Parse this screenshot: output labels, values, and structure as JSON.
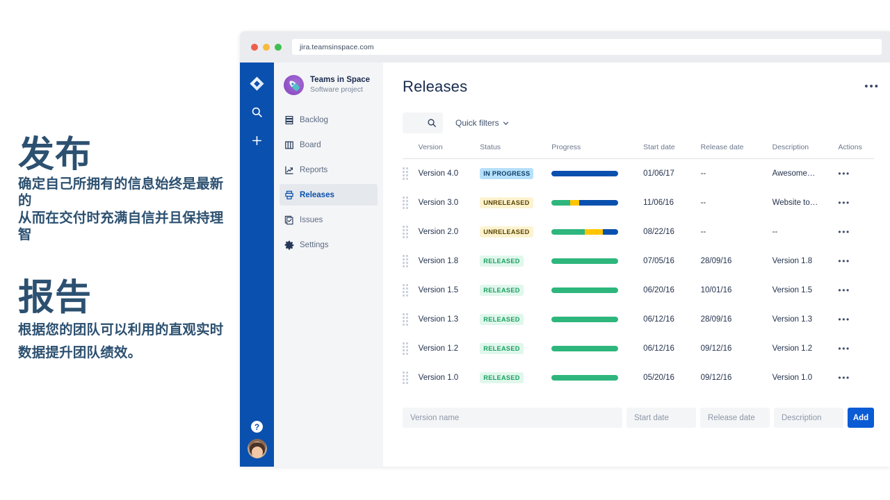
{
  "marketing": {
    "block1": {
      "heading": "发布",
      "lines": "确定自己所拥有的信息始终是最新的\n从而在交付时充满自信并且保持理智"
    },
    "block2": {
      "heading": "报告",
      "lines": "根据您的团队可以利用的直观实时数据提升团队绩效。"
    },
    "accent_color": "#2c5070"
  },
  "browser": {
    "url": "jira.teamsinspace.com",
    "traffic_lights": [
      "close-red",
      "minimize-yellow",
      "maximize-green"
    ]
  },
  "rail": {
    "logo_icon": "jira-logo-icon",
    "search_icon": "search-icon",
    "create_icon": "plus-icon",
    "help_icon": "help-icon",
    "help_label": "?",
    "avatar_icon": "user-avatar",
    "background": "#0a50ae"
  },
  "sidebar": {
    "project": {
      "name": "Teams in Space",
      "type": "Software project",
      "avatar_icon": "rocket-avatar-icon"
    },
    "items": [
      {
        "label": "Backlog",
        "icon": "backlog-icon",
        "active": false
      },
      {
        "label": "Board",
        "icon": "board-icon",
        "active": false
      },
      {
        "label": "Reports",
        "icon": "reports-icon",
        "active": false
      },
      {
        "label": "Releases",
        "icon": "releases-icon",
        "active": true
      },
      {
        "label": "Issues",
        "icon": "issues-icon",
        "active": false
      },
      {
        "label": "Settings",
        "icon": "settings-icon",
        "active": false
      }
    ]
  },
  "main": {
    "title": "Releases",
    "more_actions": "•••",
    "search": {
      "placeholder": "",
      "value": "",
      "icon": "search-icon"
    },
    "quick_filters": {
      "label": "Quick filters",
      "icon": "chevron-down-icon"
    },
    "columns": [
      "Version",
      "Status",
      "Progress",
      "Start date",
      "Release date",
      "Description",
      "Actions"
    ],
    "rows": [
      {
        "version": "Version 4.0",
        "status": "IN PROGRESS",
        "status_kind": "inprogress",
        "progress": [
          {
            "color": "#0a50ae",
            "pct": 100
          }
        ],
        "start_date": "01/06/17",
        "release_date": "--",
        "description": "Awesome…",
        "actions": "•••"
      },
      {
        "version": "Version 3.0",
        "status": "UNRELEASED",
        "status_kind": "unreleased",
        "progress": [
          {
            "color": "#2eb67d",
            "pct": 28
          },
          {
            "color": "#ffc400",
            "pct": 13
          },
          {
            "color": "#0a50ae",
            "pct": 59
          }
        ],
        "start_date": "11/06/16",
        "release_date": "--",
        "description": "Website to…",
        "actions": "•••"
      },
      {
        "version": "Version 2.0",
        "status": "UNRELEASED",
        "status_kind": "unreleased",
        "progress": [
          {
            "color": "#2eb67d",
            "pct": 50
          },
          {
            "color": "#ffc400",
            "pct": 27
          },
          {
            "color": "#0a50ae",
            "pct": 23
          }
        ],
        "start_date": "08/22/16",
        "release_date": "--",
        "description": "--",
        "actions": "•••"
      },
      {
        "version": "Version 1.8",
        "status": "RELEASED",
        "status_kind": "released",
        "progress": [
          {
            "color": "#2eb67d",
            "pct": 100
          }
        ],
        "start_date": "07/05/16",
        "release_date": "28/09/16",
        "description": "Version 1.8",
        "actions": "•••"
      },
      {
        "version": "Version 1.5",
        "status": "RELEASED",
        "status_kind": "released",
        "progress": [
          {
            "color": "#2eb67d",
            "pct": 100
          }
        ],
        "start_date": "06/20/16",
        "release_date": "10/01/16",
        "description": "Version 1.5",
        "actions": "•••"
      },
      {
        "version": "Version 1.3",
        "status": "RELEASED",
        "status_kind": "released",
        "progress": [
          {
            "color": "#2eb67d",
            "pct": 100
          }
        ],
        "start_date": "06/12/16",
        "release_date": "28/09/16",
        "description": "Version 1.3",
        "actions": "•••"
      },
      {
        "version": "Version 1.2",
        "status": "RELEASED",
        "status_kind": "released",
        "progress": [
          {
            "color": "#2eb67d",
            "pct": 100
          }
        ],
        "start_date": "06/12/16",
        "release_date": "09/12/16",
        "description": "Version 1.2",
        "actions": "•••"
      },
      {
        "version": "Version 1.0",
        "status": "RELEASED",
        "status_kind": "released",
        "progress": [
          {
            "color": "#2eb67d",
            "pct": 100
          }
        ],
        "start_date": "05/20/16",
        "release_date": "09/12/16",
        "description": "Version 1.0",
        "actions": "•••"
      }
    ],
    "add_form": {
      "version_placeholder": "Version name",
      "start_placeholder": "Start date",
      "release_placeholder": "Release date",
      "description_placeholder": "Description",
      "add_label": "Add"
    }
  },
  "colors": {
    "jira_blue": "#0a50ae",
    "add_button": "#0a5bd4",
    "green": "#2eb67d",
    "yellow": "#ffc400",
    "badge_inprogress_bg": "#b6e0fa",
    "badge_unreleased_bg": "#fdf3d0",
    "badge_released_bg": "#e0f7ec"
  }
}
